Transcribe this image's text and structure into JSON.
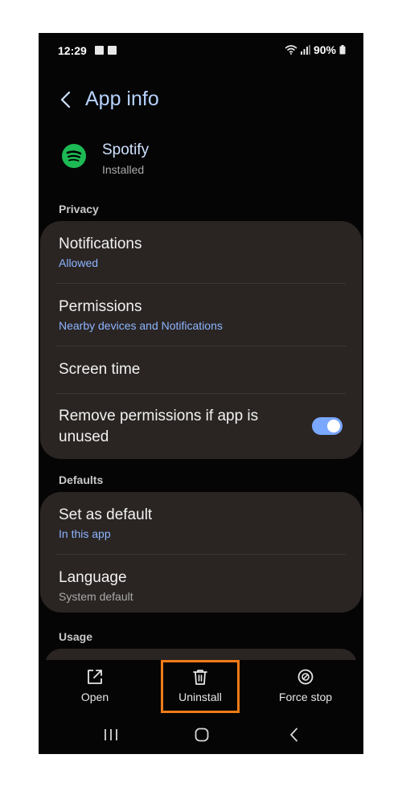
{
  "status": {
    "time": "12:29",
    "battery": "90%"
  },
  "header": {
    "title": "App info"
  },
  "app": {
    "name": "Spotify",
    "state": "Installed"
  },
  "privacy": {
    "section_label": "Privacy",
    "notifications": {
      "label": "Notifications",
      "value": "Allowed"
    },
    "permissions": {
      "label": "Permissions",
      "value": "Nearby devices and Notifications"
    },
    "screen_time": {
      "label": "Screen time"
    },
    "remove_permissions": {
      "label": "Remove permissions if app is unused",
      "enabled": true
    }
  },
  "defaults": {
    "section_label": "Defaults",
    "set_as_default": {
      "label": "Set as default",
      "value": "In this app"
    },
    "language": {
      "label": "Language",
      "value": "System default"
    }
  },
  "usage": {
    "section_label": "Usage"
  },
  "actions": {
    "open": "Open",
    "uninstall": "Uninstall",
    "force_stop": "Force stop"
  },
  "colors": {
    "accent": "#b7d2ff",
    "link": "#8db4ff",
    "card": "#2a2523",
    "highlight": "#f07b17",
    "toggle": "#7aa7ff",
    "spotify": "#1db954"
  },
  "icons": [
    "gallery-icon",
    "check-icon",
    "wifi-icon",
    "signal-icon",
    "battery-icon",
    "back-icon",
    "spotify-icon",
    "open-icon",
    "trash-icon",
    "force-stop-icon",
    "recents-icon",
    "home-icon",
    "nav-back-icon"
  ]
}
